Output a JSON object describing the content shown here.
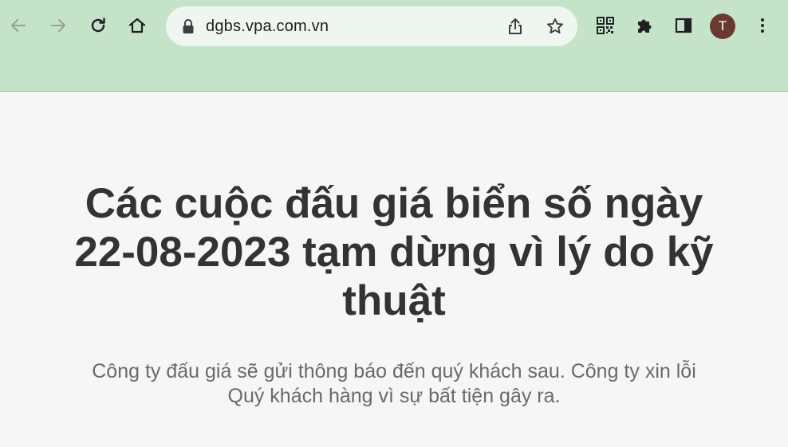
{
  "browser": {
    "url": "dgbs.vpa.com.vn",
    "profile_initial": "T",
    "toolbar_color": "#c5e3c9",
    "avatar_color": "#6b3a2e",
    "icons": {
      "back": "arrow-left-icon",
      "forward": "arrow-right-icon",
      "reload": "reload-icon",
      "home": "home-icon",
      "lock": "lock-icon",
      "share": "share-icon",
      "bookmark": "star-icon",
      "qr": "qr-code-icon",
      "extensions": "puzzle-icon",
      "side_panel": "side-panel-icon",
      "menu": "kebab-menu-icon"
    }
  },
  "page": {
    "headline_lines": [
      "Các cuộc đấu giá biển số ngày",
      "22-08-2023 tạm dừng vì lý do kỹ",
      "thuật"
    ],
    "message_lines": [
      "Công ty đấu giá sẽ gửi thông báo đến quý khách sau. Công ty xin lỗi",
      "Quý khách hàng vì sự bất tiện gây ra."
    ]
  }
}
